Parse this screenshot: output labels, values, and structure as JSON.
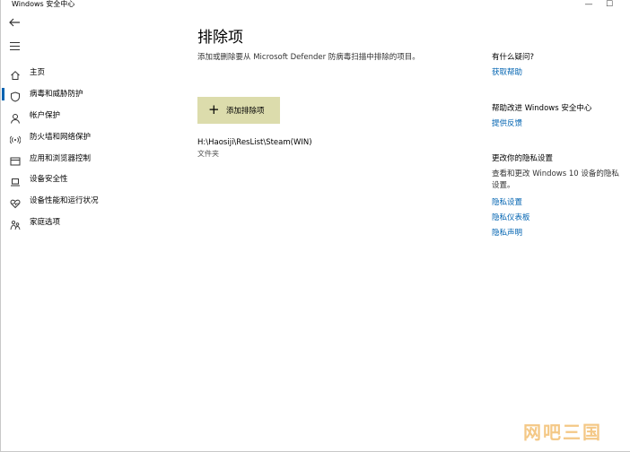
{
  "window": {
    "title": "Windows 安全中心",
    "minimize_glyph": "—",
    "maximize_glyph": "☐"
  },
  "sidebar": {
    "back_icon": "back-arrow-icon",
    "menu_icon": "hamburger-icon",
    "items": [
      {
        "label": "主页",
        "icon": "home-icon"
      },
      {
        "label": "病毒和威胁防护",
        "icon": "shield-icon",
        "active": true
      },
      {
        "label": "帐户保护",
        "icon": "person-icon"
      },
      {
        "label": "防火墙和网络保护",
        "icon": "wifi-icon"
      },
      {
        "label": "应用和浏览器控制",
        "icon": "app-window-icon"
      },
      {
        "label": "设备安全性",
        "icon": "laptop-icon"
      },
      {
        "label": "设备性能和运行状况",
        "icon": "heart-icon"
      },
      {
        "label": "家庭选项",
        "icon": "family-icon"
      }
    ]
  },
  "main": {
    "title": "排除项",
    "description": "添加或删除要从 Microsoft Defender 防病毒扫描中排除的项目。",
    "add_button": {
      "plus": "+",
      "label": "添加排除项"
    },
    "exclusions": [
      {
        "path": "H:\\Haosiji\\ResList\\Steam(WIN)",
        "type": "文件夹"
      }
    ]
  },
  "right_column": {
    "questions": {
      "heading": "有什么疑问?",
      "link": "获取帮助"
    },
    "improve": {
      "heading": "帮助改进 Windows 安全中心",
      "link": "提供反馈"
    },
    "privacy": {
      "heading": "更改你的隐私设置",
      "text": "查看和更改 Windows 10 设备的隐私设置。",
      "links": [
        "隐私设置",
        "隐私仪表板",
        "隐私声明"
      ]
    }
  },
  "watermark": "网吧三国",
  "colors": {
    "accent": "#0063b1",
    "button_bg": "#dcdcac"
  }
}
